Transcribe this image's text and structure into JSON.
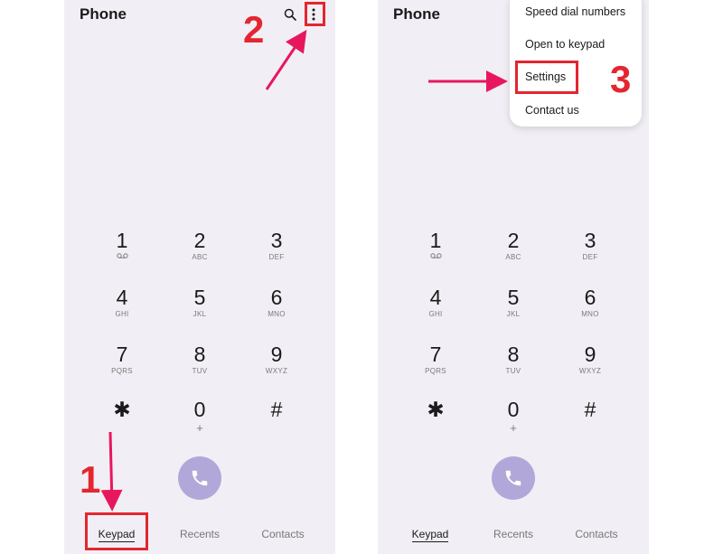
{
  "left_screen": {
    "title": "Phone",
    "keys": [
      {
        "digit": "1",
        "letters": "QO"
      },
      {
        "digit": "2",
        "letters": "ABC"
      },
      {
        "digit": "3",
        "letters": "DEF"
      },
      {
        "digit": "4",
        "letters": "GHI"
      },
      {
        "digit": "5",
        "letters": "JKL"
      },
      {
        "digit": "6",
        "letters": "MNO"
      },
      {
        "digit": "7",
        "letters": "PQRS"
      },
      {
        "digit": "8",
        "letters": "TUV"
      },
      {
        "digit": "9",
        "letters": "WXYZ"
      },
      {
        "digit": "✱",
        "letters": ""
      },
      {
        "digit": "0",
        "letters": "+"
      },
      {
        "digit": "#",
        "letters": ""
      }
    ],
    "tabs": {
      "keypad": "Keypad",
      "recents": "Recents",
      "contacts": "Contacts"
    }
  },
  "right_screen": {
    "title": "Phone",
    "menu": {
      "speed_dial": "Speed dial numbers",
      "open_keypad": "Open to keypad",
      "settings": "Settings",
      "contact_us": "Contact us"
    },
    "keys": [
      {
        "digit": "1",
        "letters": "QO"
      },
      {
        "digit": "2",
        "letters": "ABC"
      },
      {
        "digit": "3",
        "letters": "DEF"
      },
      {
        "digit": "4",
        "letters": "GHI"
      },
      {
        "digit": "5",
        "letters": "JKL"
      },
      {
        "digit": "6",
        "letters": "MNO"
      },
      {
        "digit": "7",
        "letters": "PQRS"
      },
      {
        "digit": "8",
        "letters": "TUV"
      },
      {
        "digit": "9",
        "letters": "WXYZ"
      },
      {
        "digit": "✱",
        "letters": ""
      },
      {
        "digit": "0",
        "letters": "+"
      },
      {
        "digit": "#",
        "letters": ""
      }
    ],
    "tabs": {
      "keypad": "Keypad",
      "recents": "Recents",
      "contacts": "Contacts"
    }
  },
  "annotations": {
    "step1": "1",
    "step2": "2",
    "step3": "3"
  },
  "colors": {
    "annotation_red": "#e3262f",
    "arrow_pink": "#e8175d",
    "call_button": "#b1a8d9",
    "screen_bg": "#f1eff5"
  },
  "icons": {
    "search": "search-icon",
    "more": "more-vertical-icon",
    "call": "phone-icon",
    "voicemail": "voicemail-icon"
  }
}
